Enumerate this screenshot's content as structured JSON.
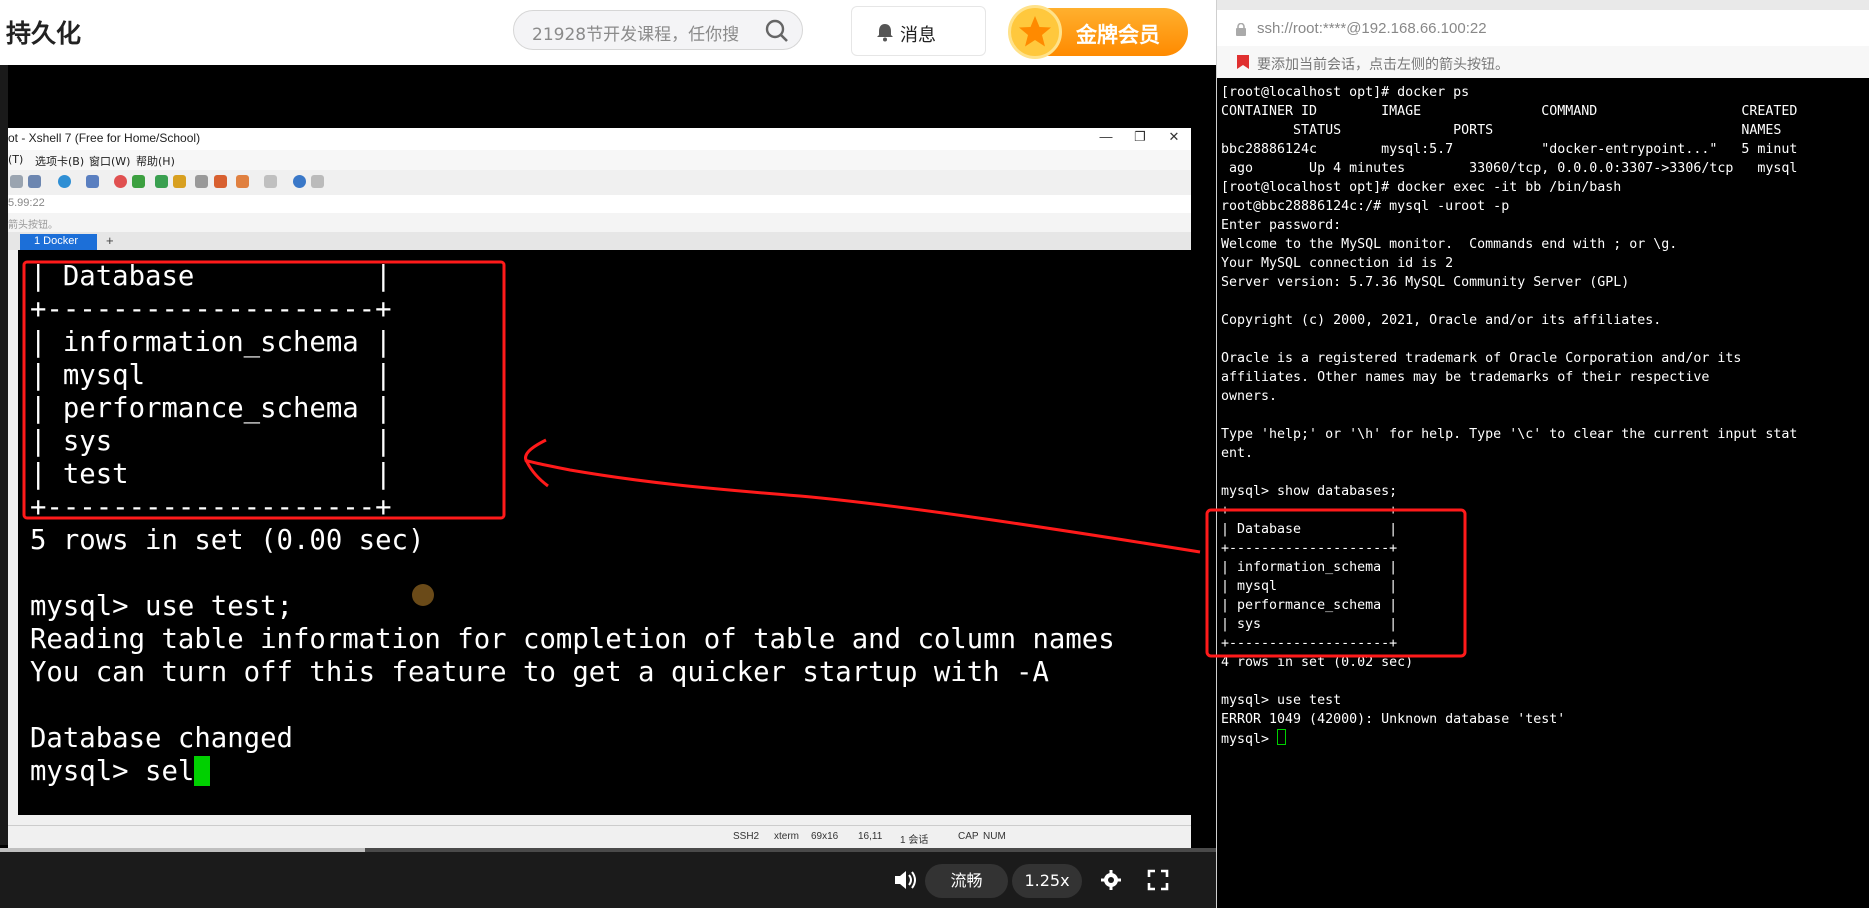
{
  "header": {
    "site_title": "持久化",
    "search_placeholder": "21928节开发课程，任你搜",
    "messages_label": "消息",
    "vip_label": "金牌会员"
  },
  "xshell": {
    "window_title": "ot - Xshell 7 (Free for Home/School)",
    "menu": [
      "(T)",
      "选项卡(B)",
      "窗口(W)",
      "帮助(H)"
    ],
    "address": "5.99:22",
    "hint": "箭头按钮。",
    "tab_label": "1 Docker",
    "terminal_lines": [
      "| Database           |",
      "+--------------------+",
      "| information_schema |",
      "| mysql              |",
      "| performance_schema |",
      "| sys                |",
      "| test               |",
      "+--------------------+",
      "5 rows in set (0.00 sec)",
      "",
      "mysql> use test;",
      "Reading table information for completion of table and column names",
      "You can turn off this feature to get a quicker startup with -A",
      "",
      "Database changed"
    ],
    "prompt_input": "mysql> sel",
    "status": {
      "protocol": "SSH2",
      "terminal": "xterm",
      "size": "69x16",
      "cursor": "16,11",
      "sessions": "1 会话",
      "caps": "CAP",
      "num": "NUM"
    }
  },
  "player": {
    "progress": 0.3,
    "quality_label": "流畅",
    "speed_label": "1.25x"
  },
  "right_terminal": {
    "address": "ssh://root:****@192.168.66.100:22",
    "hint": "要添加当前会话，点击左侧的箭头按钮。",
    "lines": [
      "[root@localhost opt]# docker ps",
      "CONTAINER ID        IMAGE               COMMAND                  CREATED",
      "         STATUS              PORTS                               NAMES",
      "bbc28886124c        mysql:5.7           \"docker-entrypoint...\"   5 minut",
      " ago       Up 4 minutes        33060/tcp, 0.0.0.0:3307->3306/tcp   mysql",
      "[root@localhost opt]# docker exec -it bb /bin/bash",
      "root@bbc28886124c:/# mysql -uroot -p",
      "Enter password:",
      "Welcome to the MySQL monitor.  Commands end with ; or \\g.",
      "Your MySQL connection id is 2",
      "Server version: 5.7.36 MySQL Community Server (GPL)",
      "",
      "Copyright (c) 2000, 2021, Oracle and/or its affiliates.",
      "",
      "Oracle is a registered trademark of Oracle Corporation and/or its",
      "affiliates. Other names may be trademarks of their respective",
      "owners.",
      "",
      "Type 'help;' or '\\h' for help. Type '\\c' to clear the current input stat",
      "ent.",
      "",
      "mysql> show databases;",
      "+--------------------+",
      "| Database           |",
      "+--------------------+",
      "| information_schema |",
      "| mysql              |",
      "| performance_schema |",
      "| sys                |",
      "+--------------------+",
      "4 rows in set (0.02 sec)",
      "",
      "mysql> use test",
      "ERROR 1049 (42000): Unknown database 'test'"
    ],
    "prompt": "mysql> "
  },
  "colors": {
    "annotation_red": "#ff1a1a",
    "cursor_green": "#00d000",
    "vip_orange": "#ff9a1a",
    "tab_blue": "#1c6fd8"
  }
}
